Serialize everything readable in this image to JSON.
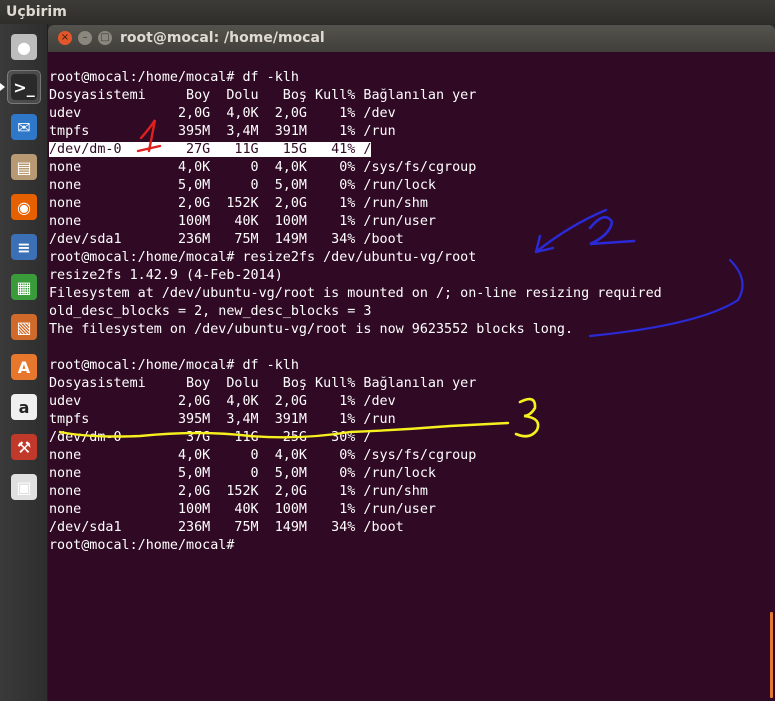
{
  "topbar": {
    "app_title": "Uçbirim"
  },
  "launcher": {
    "items": [
      {
        "name": "dash-home-icon",
        "glyph": "●",
        "color": "#bdbdbd"
      },
      {
        "name": "terminal-icon",
        "glyph": ">_",
        "color": "#2a2a2a"
      },
      {
        "name": "thunderbird-icon",
        "glyph": "✉",
        "color": "#2f77c9"
      },
      {
        "name": "files-icon",
        "glyph": "▤",
        "color": "#b79a73"
      },
      {
        "name": "firefox-icon",
        "glyph": "◉",
        "color": "#e66000"
      },
      {
        "name": "writer-icon",
        "glyph": "≡",
        "color": "#3b6fb6"
      },
      {
        "name": "calc-icon",
        "glyph": "▦",
        "color": "#3a9b3a"
      },
      {
        "name": "impress-icon",
        "glyph": "▧",
        "color": "#d06a2b"
      },
      {
        "name": "software-center-icon",
        "glyph": "A",
        "color": "#e8772e"
      },
      {
        "name": "amazon-icon",
        "glyph": "a",
        "color": "#f0f0f0"
      },
      {
        "name": "system-settings-icon",
        "glyph": "⚒",
        "color": "#c0392b"
      },
      {
        "name": "floppy-save-icon",
        "glyph": "▣",
        "color": "#e0e0e0"
      }
    ]
  },
  "window": {
    "title": "root@mocal: /home/mocal",
    "close_glyph": "×",
    "minimize_glyph": "–",
    "maximize_glyph": "□"
  },
  "terminal": {
    "lines": [
      "root@mocal:/home/mocal# df -klh",
      "Dosyasistemi     Boy  Dolu   Boş Kull% Bağlanılan yer",
      "udev            2,0G  4,0K  2,0G    1% /dev",
      "tmpfs           395M  3,4M  391M    1% /run",
      "/dev/dm-0        27G   11G   15G   41% /",
      "none            4,0K     0  4,0K    0% /sys/fs/cgroup",
      "none            5,0M     0  5,0M    0% /run/lock",
      "none            2,0G  152K  2,0G    1% /run/shm",
      "none            100M   40K  100M    1% /run/user",
      "/dev/sda1       236M   75M  149M   34% /boot",
      "root@mocal:/home/mocal# resize2fs /dev/ubuntu-vg/root",
      "resize2fs 1.42.9 (4-Feb-2014)",
      "Filesystem at /dev/ubuntu-vg/root is mounted on /; on-line resizing required",
      "old_desc_blocks = 2, new_desc_blocks = 3",
      "The filesystem on /dev/ubuntu-vg/root is now 9623552 blocks long.",
      "",
      "root@mocal:/home/mocal# df -klh",
      "Dosyasistemi     Boy  Dolu   Boş Kull% Bağlanılan yer",
      "udev            2,0G  4,0K  2,0G    1% /dev",
      "tmpfs           395M  3,4M  391M    1% /run",
      "/dev/dm-0        37G   11G   25G   30% /",
      "none            4,0K     0  4,0K    0% /sys/fs/cgroup",
      "none            5,0M     0  5,0M    0% /run/lock",
      "none            2,0G  152K  2,0G    1% /run/shm",
      "none            100M   40K  100M    1% /run/user",
      "/dev/sda1       236M   75M  149M   34% /boot",
      "root@mocal:/home/mocal# "
    ],
    "highlighted_line": 4
  },
  "annotations": {
    "label_1": "1",
    "label_2": "2",
    "label_3": "3",
    "color_1": "#e0201c",
    "color_2": "#2a2ad8",
    "color_3": "#f5f01e"
  }
}
